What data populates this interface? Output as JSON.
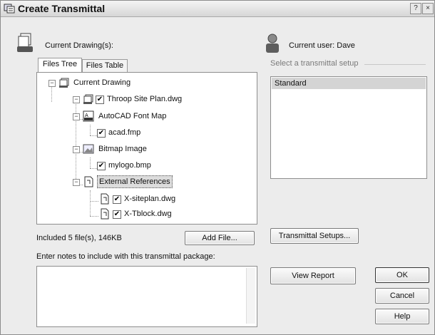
{
  "window": {
    "title": "Create Transmittal",
    "help_glyph": "?",
    "close_glyph": "×"
  },
  "left": {
    "current_drawings_label": "Current Drawing(s):",
    "tabs": [
      {
        "label": "Files Tree"
      },
      {
        "label": "Files Table"
      }
    ],
    "tree": {
      "root": "Current Drawing",
      "drawing": "Throop Site Plan.dwg",
      "font_map": "AutoCAD Font Map",
      "font_file": "acad.fmp",
      "bitmap": "Bitmap Image",
      "bitmap_file": "mylogo.bmp",
      "xrefs": "External References",
      "xref1": "X-siteplan.dwg",
      "xref2": "X-Tblock.dwg"
    },
    "included_text": "Included 5 file(s), 146KB",
    "add_file_label": "Add File...",
    "notes_label": "Enter notes to include with this transmittal package:"
  },
  "right": {
    "current_user_label": "Current user: Dave",
    "select_setup_label": "Select a transmittal setup",
    "setups": [
      "Standard"
    ],
    "transmittal_setups_label": "Transmittal Setups...",
    "view_report_label": "View Report",
    "ok_label": "OK",
    "cancel_label": "Cancel",
    "help_label": "Help"
  },
  "icons": {
    "title": "transmittal-icon",
    "drawings": "drawings-stack-icon",
    "user": "user-icon",
    "font_map": "font-map-icon",
    "bitmap": "bitmap-image-icon",
    "xref": "xref-page-icon"
  }
}
